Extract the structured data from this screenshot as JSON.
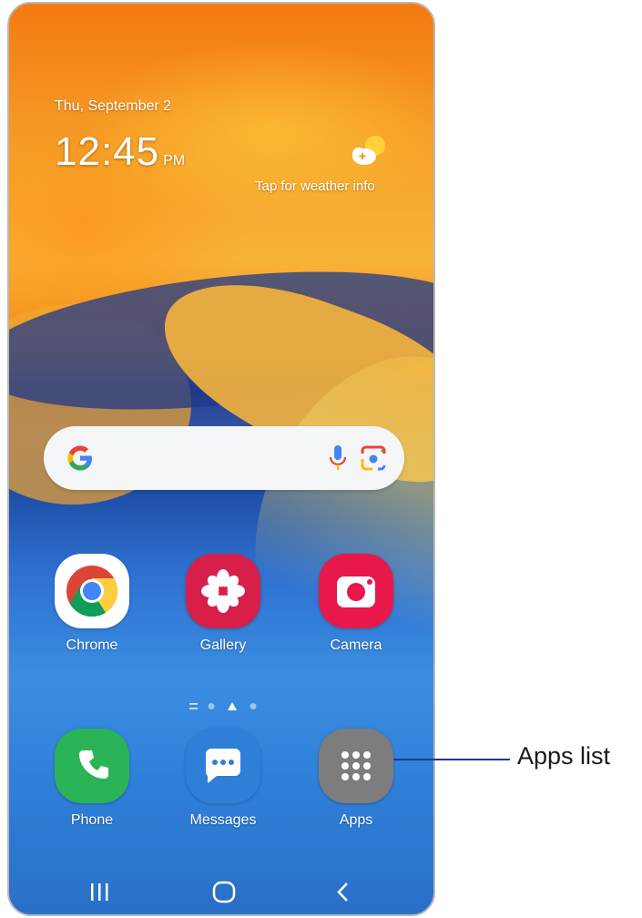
{
  "lock_screen": {
    "date": "Thu, September 2",
    "time": "12:45",
    "ampm": "PM",
    "weather_text": "Tap for weather info"
  },
  "search_bar": {
    "logo": "google-g-icon",
    "mic_icon": "microphone-icon",
    "lens_icon": "google-lens-icon"
  },
  "apps_row": [
    {
      "label": "Chrome",
      "icon": "chrome-icon",
      "color": "#ffffff"
    },
    {
      "label": "Gallery",
      "icon": "gallery-flower-icon",
      "color": "#d81f4a"
    },
    {
      "label": "Camera",
      "icon": "camera-icon",
      "color": "#e8194a"
    }
  ],
  "page_indicator": {
    "pages": 3,
    "current": 2
  },
  "dock": [
    {
      "label": "Phone",
      "icon": "phone-icon",
      "color": "#2bb357"
    },
    {
      "label": "Messages",
      "icon": "messages-icon",
      "color": "#2f7fd8"
    },
    {
      "label": "Apps",
      "icon": "apps-grid-icon",
      "color": "#7d7d7d"
    }
  ],
  "nav_bar": {
    "recents": "recents-icon",
    "home": "home-icon",
    "back": "back-icon"
  },
  "callout": {
    "label": "Apps list",
    "color": "#1e3a8a"
  }
}
